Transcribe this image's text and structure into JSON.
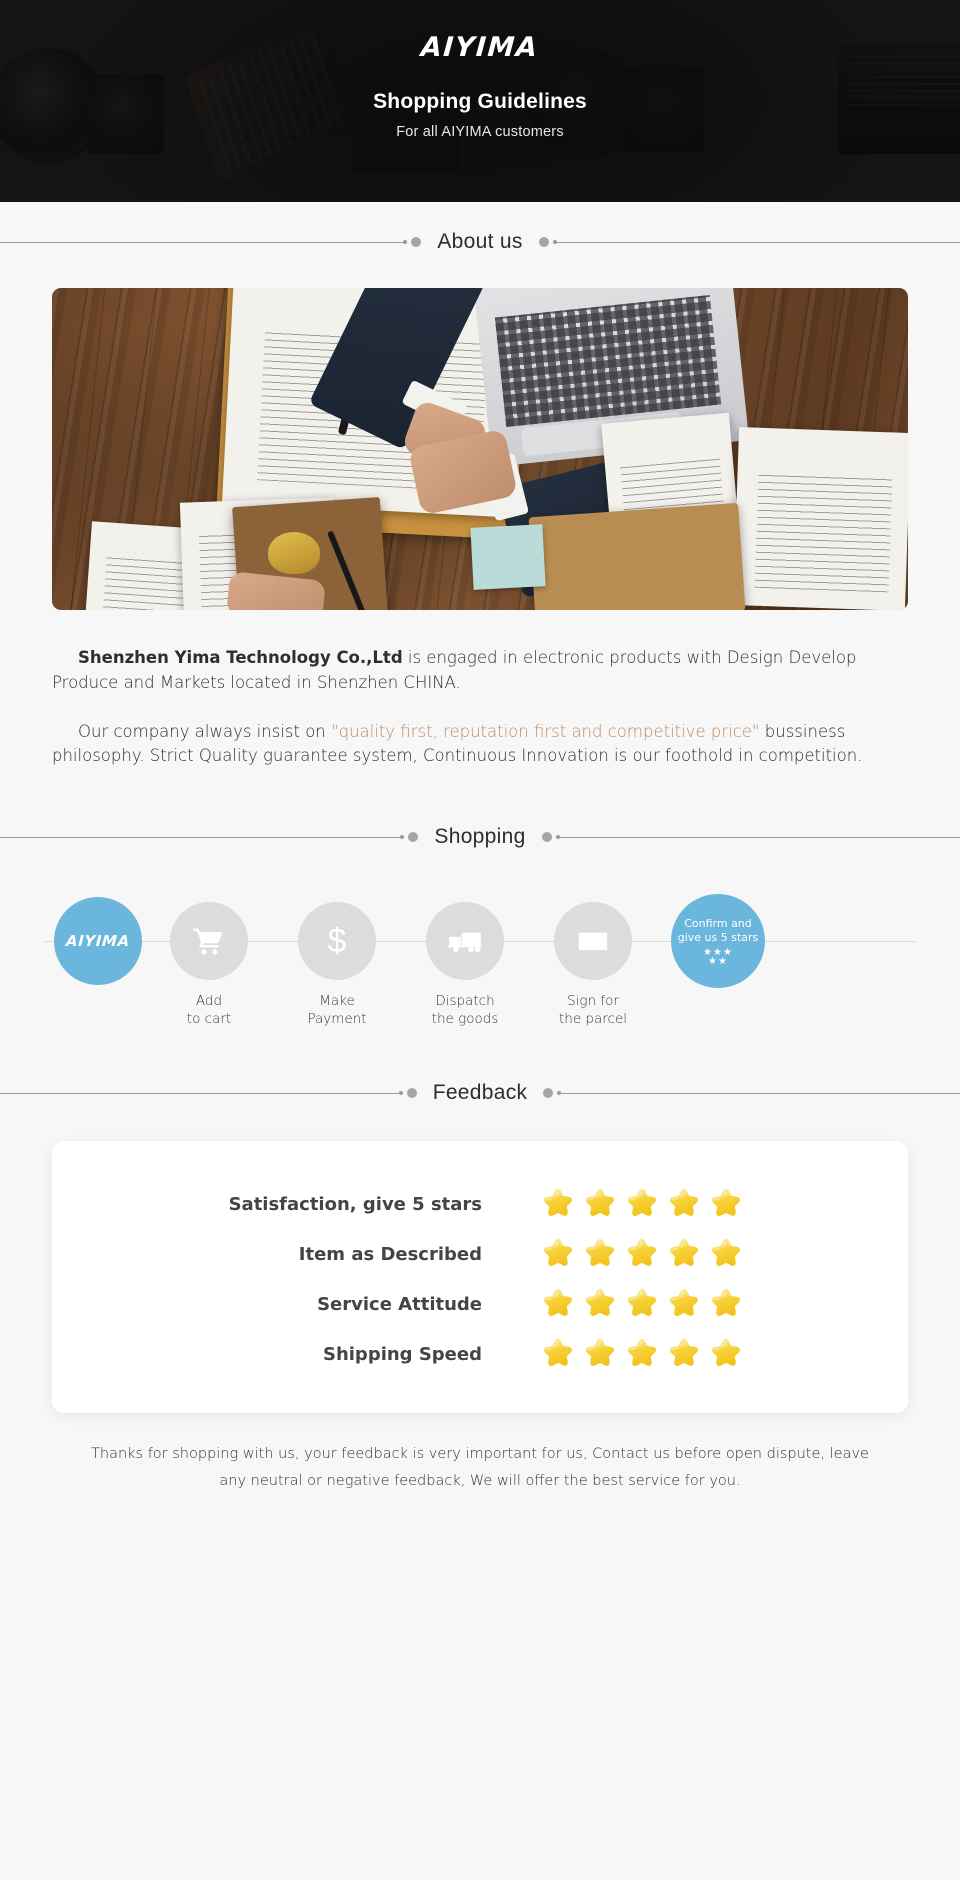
{
  "hero": {
    "logo": "AIYIMA",
    "title": "Shopping Guidelines",
    "subtitle": "For all AIYIMA customers"
  },
  "sections": {
    "about": "About us",
    "shopping": "Shopping",
    "feedback": "Feedback"
  },
  "about": {
    "p1_bold": "Shenzhen Yima Technology Co.,Ltd",
    "p1_rest": " is engaged in electronic products with Design Develop Produce and Markets located in Shenzhen CHINA.",
    "p2_pre": "Our company always insist on ",
    "p2_quote": "\"quality first, reputation first and competitive price\"",
    "p2_post": " bussiness philosophy. Strict Quality guarantee system, Continuous Innovation is our foothold in competition."
  },
  "shopping": {
    "steps": [
      {
        "icon": "aiyima-logo-icon",
        "logo": "AIYIMA",
        "line1": "",
        "line2": "",
        "style": "blue-logo"
      },
      {
        "icon": "cart-icon",
        "line1": "Add",
        "line2": "to cart",
        "style": "grey"
      },
      {
        "icon": "dollar-icon",
        "line1": "Make",
        "line2": "Payment",
        "style": "grey"
      },
      {
        "icon": "truck-icon",
        "line1": "Dispatch",
        "line2": "the goods",
        "style": "grey"
      },
      {
        "icon": "envelope-icon",
        "line1": "Sign for",
        "line2": "the parcel",
        "style": "grey"
      },
      {
        "icon": "stars-icon",
        "line1": "Confirm and",
        "line2": "give us 5 stars",
        "style": "blue-confirm"
      }
    ],
    "confirm_stars_top": "★★★",
    "confirm_stars_bottom": "★★"
  },
  "feedback": {
    "rows": [
      {
        "label": "Satisfaction, give 5 stars",
        "stars": 5
      },
      {
        "label": "Item as Described",
        "stars": 5
      },
      {
        "label": "Service Attitude",
        "stars": 5
      },
      {
        "label": "Shipping Speed",
        "stars": 5
      }
    ],
    "note": "Thanks for shopping with us, your feedback is very important for us, Contact us before open dispute, leave any neutral or negative feedback, We will offer the best service for you."
  },
  "colors": {
    "brand_blue": "#6ab6dc",
    "accent_quote": "#c08a63",
    "star_gold": "#f7d33f",
    "hero_bg": "#161616",
    "page_bg": "#f7f7f7"
  }
}
